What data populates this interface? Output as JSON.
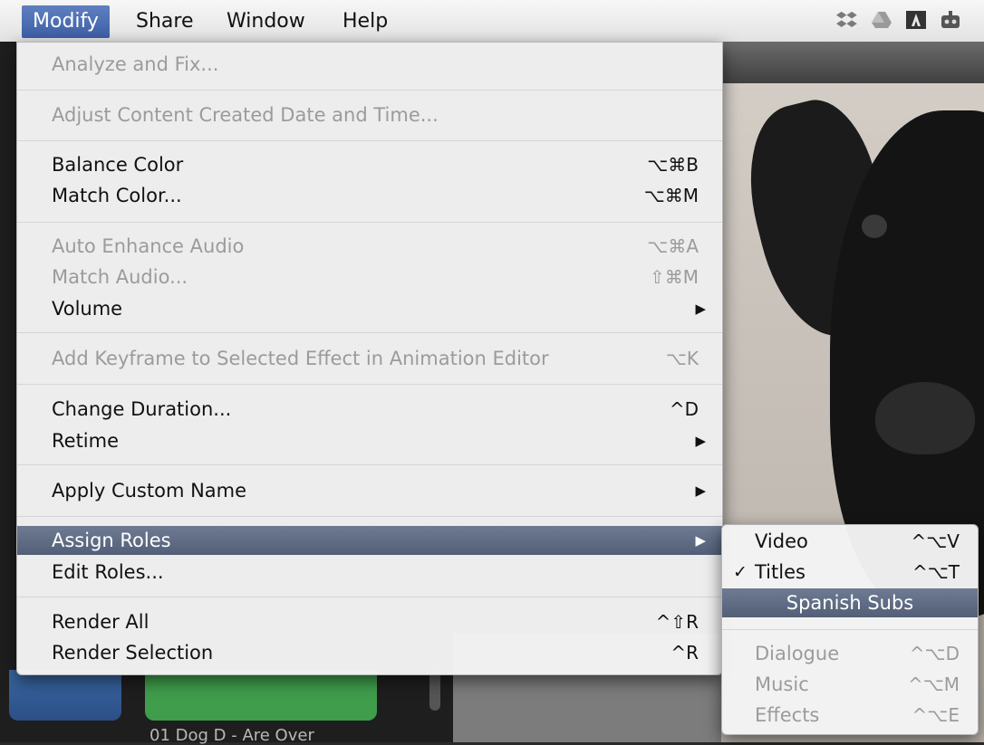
{
  "menubar": {
    "items": [
      "Modify",
      "Share",
      "Window",
      "Help"
    ],
    "active_index": 0
  },
  "tray_icons": [
    "dropbox-icon",
    "google-drive-icon",
    "adobe-icon",
    "robot-icon"
  ],
  "background": {
    "clip_label": "01 Dog D - Are Over"
  },
  "main_menu": {
    "items": [
      {
        "label": "Analyze and Fix...",
        "shortcut": "",
        "enabled": false
      },
      {
        "label": "Adjust Content Created Date and Time...",
        "shortcut": "",
        "enabled": false
      },
      {
        "label": "Balance Color",
        "shortcut": "⌥⌘B",
        "enabled": true
      },
      {
        "label": "Match Color...",
        "shortcut": "⌥⌘M",
        "enabled": true
      },
      {
        "label": "Auto Enhance Audio",
        "shortcut": "⌥⌘A",
        "enabled": false
      },
      {
        "label": "Match Audio...",
        "shortcut": "⇧⌘M",
        "enabled": false
      },
      {
        "label": "Volume",
        "shortcut": "",
        "submenu": true,
        "enabled": true
      },
      {
        "label": "Add Keyframe to Selected Effect in Animation Editor",
        "shortcut": "⌥K",
        "enabled": false
      },
      {
        "label": "Change Duration...",
        "shortcut": "^D",
        "enabled": true
      },
      {
        "label": "Retime",
        "shortcut": "",
        "submenu": true,
        "enabled": true
      },
      {
        "label": "Apply Custom Name",
        "shortcut": "",
        "submenu": true,
        "enabled": true
      },
      {
        "label": "Assign Roles",
        "shortcut": "",
        "submenu": true,
        "enabled": true,
        "highlighted": true
      },
      {
        "label": "Edit Roles...",
        "shortcut": "",
        "enabled": true
      },
      {
        "label": "Render All",
        "shortcut": "^⇧R",
        "enabled": true
      },
      {
        "label": "Render Selection",
        "shortcut": "^R",
        "enabled": true
      }
    ]
  },
  "roles_submenu": {
    "items": [
      {
        "label": "Video",
        "shortcut": "^⌥V",
        "enabled": true,
        "checked": false
      },
      {
        "label": "Titles",
        "shortcut": "^⌥T",
        "enabled": true,
        "checked": true
      },
      {
        "label": "Spanish Subs",
        "shortcut": "",
        "enabled": true,
        "highlighted": true
      },
      {
        "label": "Dialogue",
        "shortcut": "^⌥D",
        "enabled": false
      },
      {
        "label": "Music",
        "shortcut": "^⌥M",
        "enabled": false
      },
      {
        "label": "Effects",
        "shortcut": "^⌥E",
        "enabled": false
      }
    ],
    "check_glyph": "✓"
  },
  "submenu_arrow": "▶",
  "colors": {
    "highlight": "#5d6a82",
    "menubar_active": "#4a6cb0",
    "disabled_text": "#9b9b9b"
  }
}
